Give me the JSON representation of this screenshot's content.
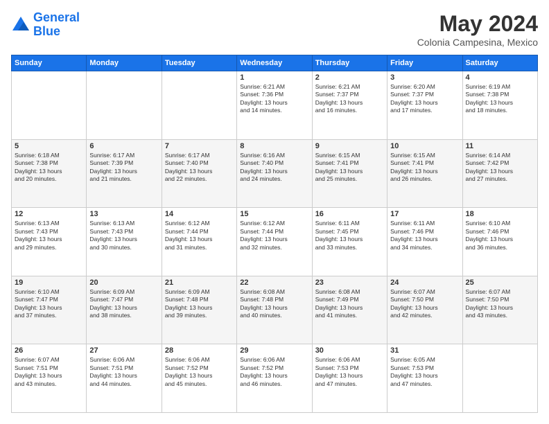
{
  "header": {
    "logo_line1": "General",
    "logo_line2": "Blue",
    "month": "May 2024",
    "location": "Colonia Campesina, Mexico"
  },
  "weekdays": [
    "Sunday",
    "Monday",
    "Tuesday",
    "Wednesday",
    "Thursday",
    "Friday",
    "Saturday"
  ],
  "weeks": [
    [
      {
        "day": "",
        "text": ""
      },
      {
        "day": "",
        "text": ""
      },
      {
        "day": "",
        "text": ""
      },
      {
        "day": "1",
        "text": "Sunrise: 6:21 AM\nSunset: 7:36 PM\nDaylight: 13 hours\nand 14 minutes."
      },
      {
        "day": "2",
        "text": "Sunrise: 6:21 AM\nSunset: 7:37 PM\nDaylight: 13 hours\nand 16 minutes."
      },
      {
        "day": "3",
        "text": "Sunrise: 6:20 AM\nSunset: 7:37 PM\nDaylight: 13 hours\nand 17 minutes."
      },
      {
        "day": "4",
        "text": "Sunrise: 6:19 AM\nSunset: 7:38 PM\nDaylight: 13 hours\nand 18 minutes."
      }
    ],
    [
      {
        "day": "5",
        "text": "Sunrise: 6:18 AM\nSunset: 7:38 PM\nDaylight: 13 hours\nand 20 minutes."
      },
      {
        "day": "6",
        "text": "Sunrise: 6:17 AM\nSunset: 7:39 PM\nDaylight: 13 hours\nand 21 minutes."
      },
      {
        "day": "7",
        "text": "Sunrise: 6:17 AM\nSunset: 7:40 PM\nDaylight: 13 hours\nand 22 minutes."
      },
      {
        "day": "8",
        "text": "Sunrise: 6:16 AM\nSunset: 7:40 PM\nDaylight: 13 hours\nand 24 minutes."
      },
      {
        "day": "9",
        "text": "Sunrise: 6:15 AM\nSunset: 7:41 PM\nDaylight: 13 hours\nand 25 minutes."
      },
      {
        "day": "10",
        "text": "Sunrise: 6:15 AM\nSunset: 7:41 PM\nDaylight: 13 hours\nand 26 minutes."
      },
      {
        "day": "11",
        "text": "Sunrise: 6:14 AM\nSunset: 7:42 PM\nDaylight: 13 hours\nand 27 minutes."
      }
    ],
    [
      {
        "day": "12",
        "text": "Sunrise: 6:13 AM\nSunset: 7:43 PM\nDaylight: 13 hours\nand 29 minutes."
      },
      {
        "day": "13",
        "text": "Sunrise: 6:13 AM\nSunset: 7:43 PM\nDaylight: 13 hours\nand 30 minutes."
      },
      {
        "day": "14",
        "text": "Sunrise: 6:12 AM\nSunset: 7:44 PM\nDaylight: 13 hours\nand 31 minutes."
      },
      {
        "day": "15",
        "text": "Sunrise: 6:12 AM\nSunset: 7:44 PM\nDaylight: 13 hours\nand 32 minutes."
      },
      {
        "day": "16",
        "text": "Sunrise: 6:11 AM\nSunset: 7:45 PM\nDaylight: 13 hours\nand 33 minutes."
      },
      {
        "day": "17",
        "text": "Sunrise: 6:11 AM\nSunset: 7:46 PM\nDaylight: 13 hours\nand 34 minutes."
      },
      {
        "day": "18",
        "text": "Sunrise: 6:10 AM\nSunset: 7:46 PM\nDaylight: 13 hours\nand 36 minutes."
      }
    ],
    [
      {
        "day": "19",
        "text": "Sunrise: 6:10 AM\nSunset: 7:47 PM\nDaylight: 13 hours\nand 37 minutes."
      },
      {
        "day": "20",
        "text": "Sunrise: 6:09 AM\nSunset: 7:47 PM\nDaylight: 13 hours\nand 38 minutes."
      },
      {
        "day": "21",
        "text": "Sunrise: 6:09 AM\nSunset: 7:48 PM\nDaylight: 13 hours\nand 39 minutes."
      },
      {
        "day": "22",
        "text": "Sunrise: 6:08 AM\nSunset: 7:48 PM\nDaylight: 13 hours\nand 40 minutes."
      },
      {
        "day": "23",
        "text": "Sunrise: 6:08 AM\nSunset: 7:49 PM\nDaylight: 13 hours\nand 41 minutes."
      },
      {
        "day": "24",
        "text": "Sunrise: 6:07 AM\nSunset: 7:50 PM\nDaylight: 13 hours\nand 42 minutes."
      },
      {
        "day": "25",
        "text": "Sunrise: 6:07 AM\nSunset: 7:50 PM\nDaylight: 13 hours\nand 43 minutes."
      }
    ],
    [
      {
        "day": "26",
        "text": "Sunrise: 6:07 AM\nSunset: 7:51 PM\nDaylight: 13 hours\nand 43 minutes."
      },
      {
        "day": "27",
        "text": "Sunrise: 6:06 AM\nSunset: 7:51 PM\nDaylight: 13 hours\nand 44 minutes."
      },
      {
        "day": "28",
        "text": "Sunrise: 6:06 AM\nSunset: 7:52 PM\nDaylight: 13 hours\nand 45 minutes."
      },
      {
        "day": "29",
        "text": "Sunrise: 6:06 AM\nSunset: 7:52 PM\nDaylight: 13 hours\nand 46 minutes."
      },
      {
        "day": "30",
        "text": "Sunrise: 6:06 AM\nSunset: 7:53 PM\nDaylight: 13 hours\nand 47 minutes."
      },
      {
        "day": "31",
        "text": "Sunrise: 6:05 AM\nSunset: 7:53 PM\nDaylight: 13 hours\nand 47 minutes."
      },
      {
        "day": "",
        "text": ""
      }
    ]
  ]
}
